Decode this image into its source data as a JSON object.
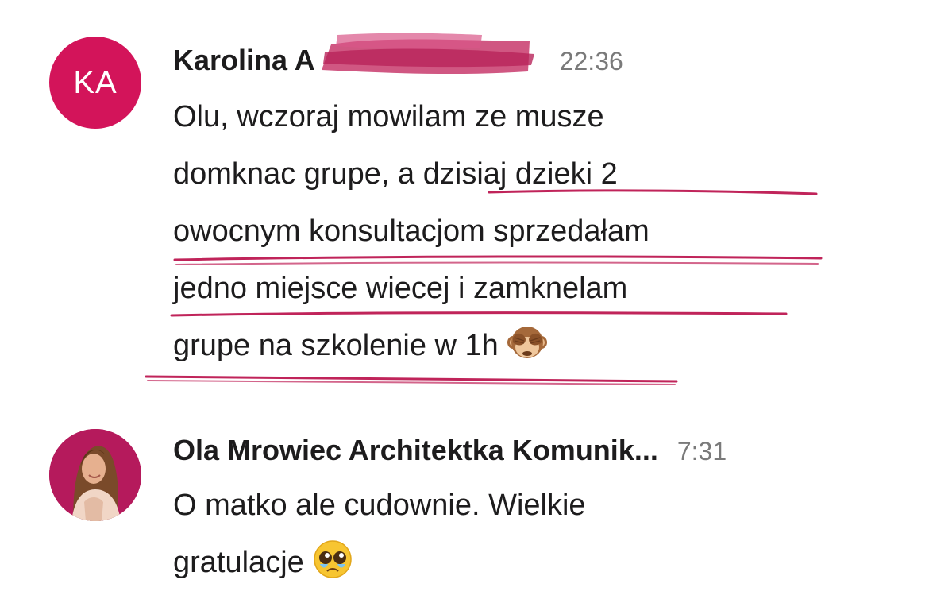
{
  "messages": [
    {
      "avatar_initials": "KA",
      "sender": "Karolina A",
      "time": "22:36",
      "lines": [
        "Olu, wczoraj mowilam ze musze",
        "domknac grupe, a dzisiaj dzieki 2",
        "owocnym konsultacjom sprzedałam",
        "jedno miejsce wiecej i zamknelam",
        "grupe na szkolenie w 1h"
      ],
      "emoji": "see-no-evil-monkey-emoji"
    },
    {
      "avatar": "profile-photo",
      "sender": "Ola Mrowiec Architektka Komunik...",
      "time": "7:31",
      "lines": [
        "O matko ale cudownie. Wielkie",
        "gratulacje"
      ],
      "emoji": "pleading-face-emoji"
    }
  ],
  "colors": {
    "avatar_bg": "#d3145a",
    "highlight_ink": "#c0245a",
    "timestamp": "#7a7a7a",
    "text": "#1d1c1d"
  }
}
